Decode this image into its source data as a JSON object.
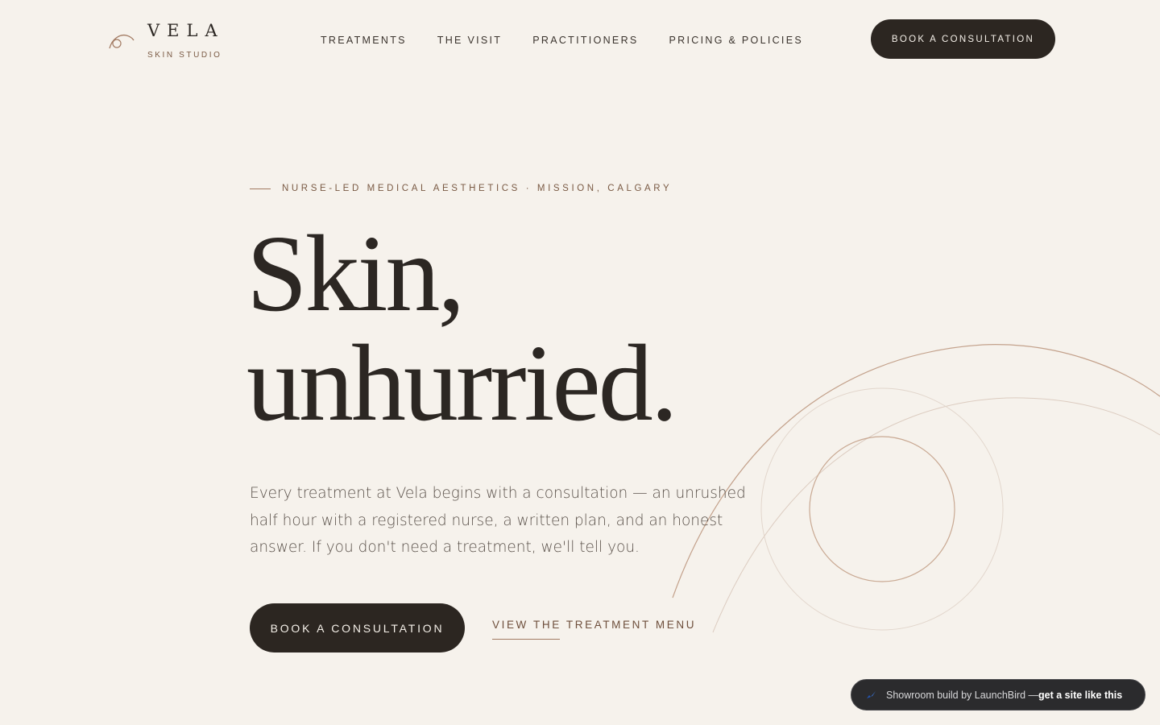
{
  "brand": {
    "name": "VELA",
    "tagline": "SKIN STUDIO"
  },
  "nav": {
    "items": [
      {
        "label": "TREATMENTS"
      },
      {
        "label": "THE VISIT"
      },
      {
        "label": "PRACTITIONERS"
      },
      {
        "label": "PRICING & POLICIES"
      }
    ],
    "cta_label": "BOOK A CONSULTATION"
  },
  "hero": {
    "eyebrow": "NURSE-LED MEDICAL AESTHETICS · MISSION, CALGARY",
    "headline_line1": "Skin,",
    "headline_line2": "unhurried.",
    "lede": "Every treatment at Vela begins with a consultation — an unrushed half hour with a registered nurse, a written plan, and an honest answer. If you don't need a treatment, we'll tell you.",
    "primary_cta": "BOOK A CONSULTATION",
    "secondary_link": "VIEW THE TREATMENT MENU"
  },
  "badge": {
    "text": "Showroom build by LaunchBird — ",
    "link": "get a site like this"
  },
  "colors": {
    "background": "#f6f2ec",
    "ink": "#2c2723",
    "accent": "#a27a62",
    "button": "#2c2621"
  },
  "icons": {
    "logo": "crescent-eye-icon",
    "badge": "launchbird-icon"
  }
}
